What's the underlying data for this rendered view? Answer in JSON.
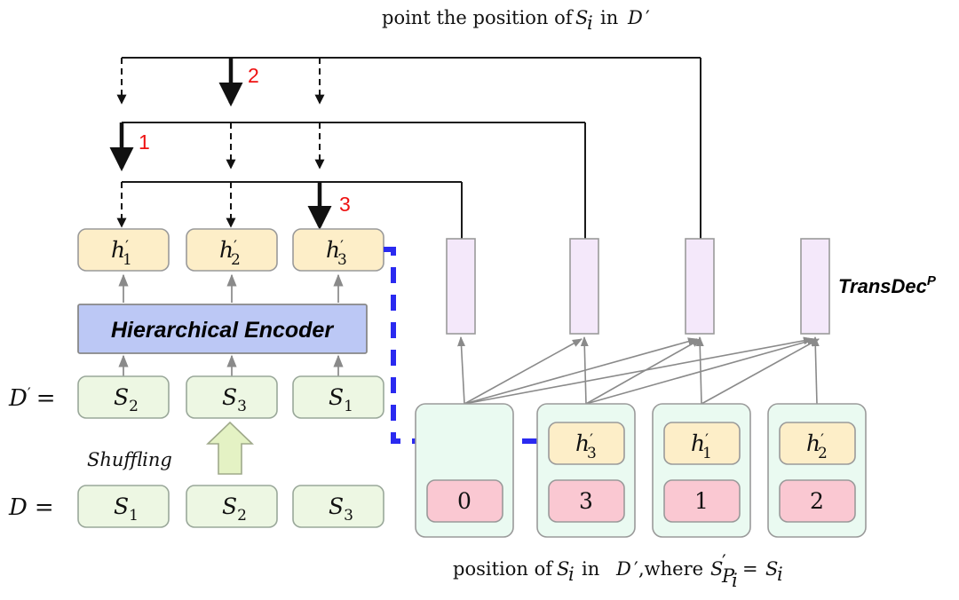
{
  "figure": {
    "title_top": "point the position of Sᵢ in 𝒟′",
    "caption_bottom": "position of  Sᵢ in  𝒟′,where S′_{Pᵢ} = Sᵢ",
    "top_caption_parts": {
      "lead": "point the position of",
      "sym1": "S",
      "sym1_sub": "i",
      "mid": "in",
      "sym2": "D",
      "sym2_prime": "′"
    },
    "bottom_caption_parts": {
      "lead": "position of",
      "sym1": "S",
      "sym1_sub": "i",
      "mid": "in",
      "sym2": "D",
      "sym2_prime": "′",
      "where": ",where",
      "sym3": "S",
      "sym3_prime": "′",
      "sym3_sub": "P",
      "sym3_subsub": "i",
      "eq": "=",
      "sym4": "S",
      "sym4_sub": "i"
    }
  },
  "encoder": {
    "label": "Hierarchical Encoder",
    "fill": "#bcc8f5",
    "stroke": "#888888"
  },
  "decoder": {
    "label": "TransDec",
    "superscript": "P",
    "bar_fill": "#f4e8fa",
    "bar_stroke": "#9a9a9a"
  },
  "shuffling": {
    "label": "Shuffling",
    "arrow_fill": "#e4f2c4",
    "arrow_stroke": "#9fa98a"
  },
  "rows": {
    "d_prime_label": "D",
    "d_prime_prime": "′",
    "d_label": "D",
    "eq": "="
  },
  "hidden_states": [
    {
      "base": "h",
      "prime": "′",
      "sub": "1"
    },
    {
      "base": "h",
      "prime": "′",
      "sub": "2"
    },
    {
      "base": "h",
      "prime": "′",
      "sub": "3"
    }
  ],
  "d_prime_segments": [
    {
      "base": "S",
      "sub": "2"
    },
    {
      "base": "S",
      "sub": "3"
    },
    {
      "base": "S",
      "sub": "1"
    }
  ],
  "d_segments": [
    {
      "base": "S",
      "sub": "1"
    },
    {
      "base": "S",
      "sub": "2"
    },
    {
      "base": "S",
      "sub": "3"
    }
  ],
  "decoder_columns": [
    {
      "hidden": null,
      "hidden_base": "",
      "hidden_prime": "",
      "hidden_sub": "",
      "position": "0",
      "has_hidden": false
    },
    {
      "hidden": "h′3",
      "hidden_base": "h",
      "hidden_prime": "′",
      "hidden_sub": "3",
      "position": "3",
      "has_hidden": true
    },
    {
      "hidden": "h′1",
      "hidden_base": "h",
      "hidden_prime": "′",
      "hidden_sub": "1",
      "position": "1",
      "has_hidden": true
    },
    {
      "hidden": "h′2",
      "hidden_base": "h",
      "hidden_prime": "′",
      "hidden_sub": "2",
      "position": "2",
      "has_hidden": true
    }
  ],
  "pointer_steps": [
    {
      "label": "1",
      "target_index": 0,
      "bus": "bottom"
    },
    {
      "label": "2",
      "target_index": 1,
      "bus": "top"
    },
    {
      "label": "3",
      "target_index": 2,
      "bus": "middle"
    }
  ],
  "colors": {
    "hidden_fill": "#fdeec8",
    "hidden_stroke": "#9a9a9a",
    "segment_fill": "#edf7e3",
    "segment_stroke": "#9aa89a",
    "position_fill": "#fac8d2",
    "position_stroke": "#9a9a9a",
    "column_fill": "#eafaf1",
    "column_stroke": "#9a9a9a",
    "accent_red": "#ee1111",
    "accent_blue": "#2a2af0",
    "arrow_gray": "#8a8a8a",
    "arrow_black": "#111111"
  }
}
